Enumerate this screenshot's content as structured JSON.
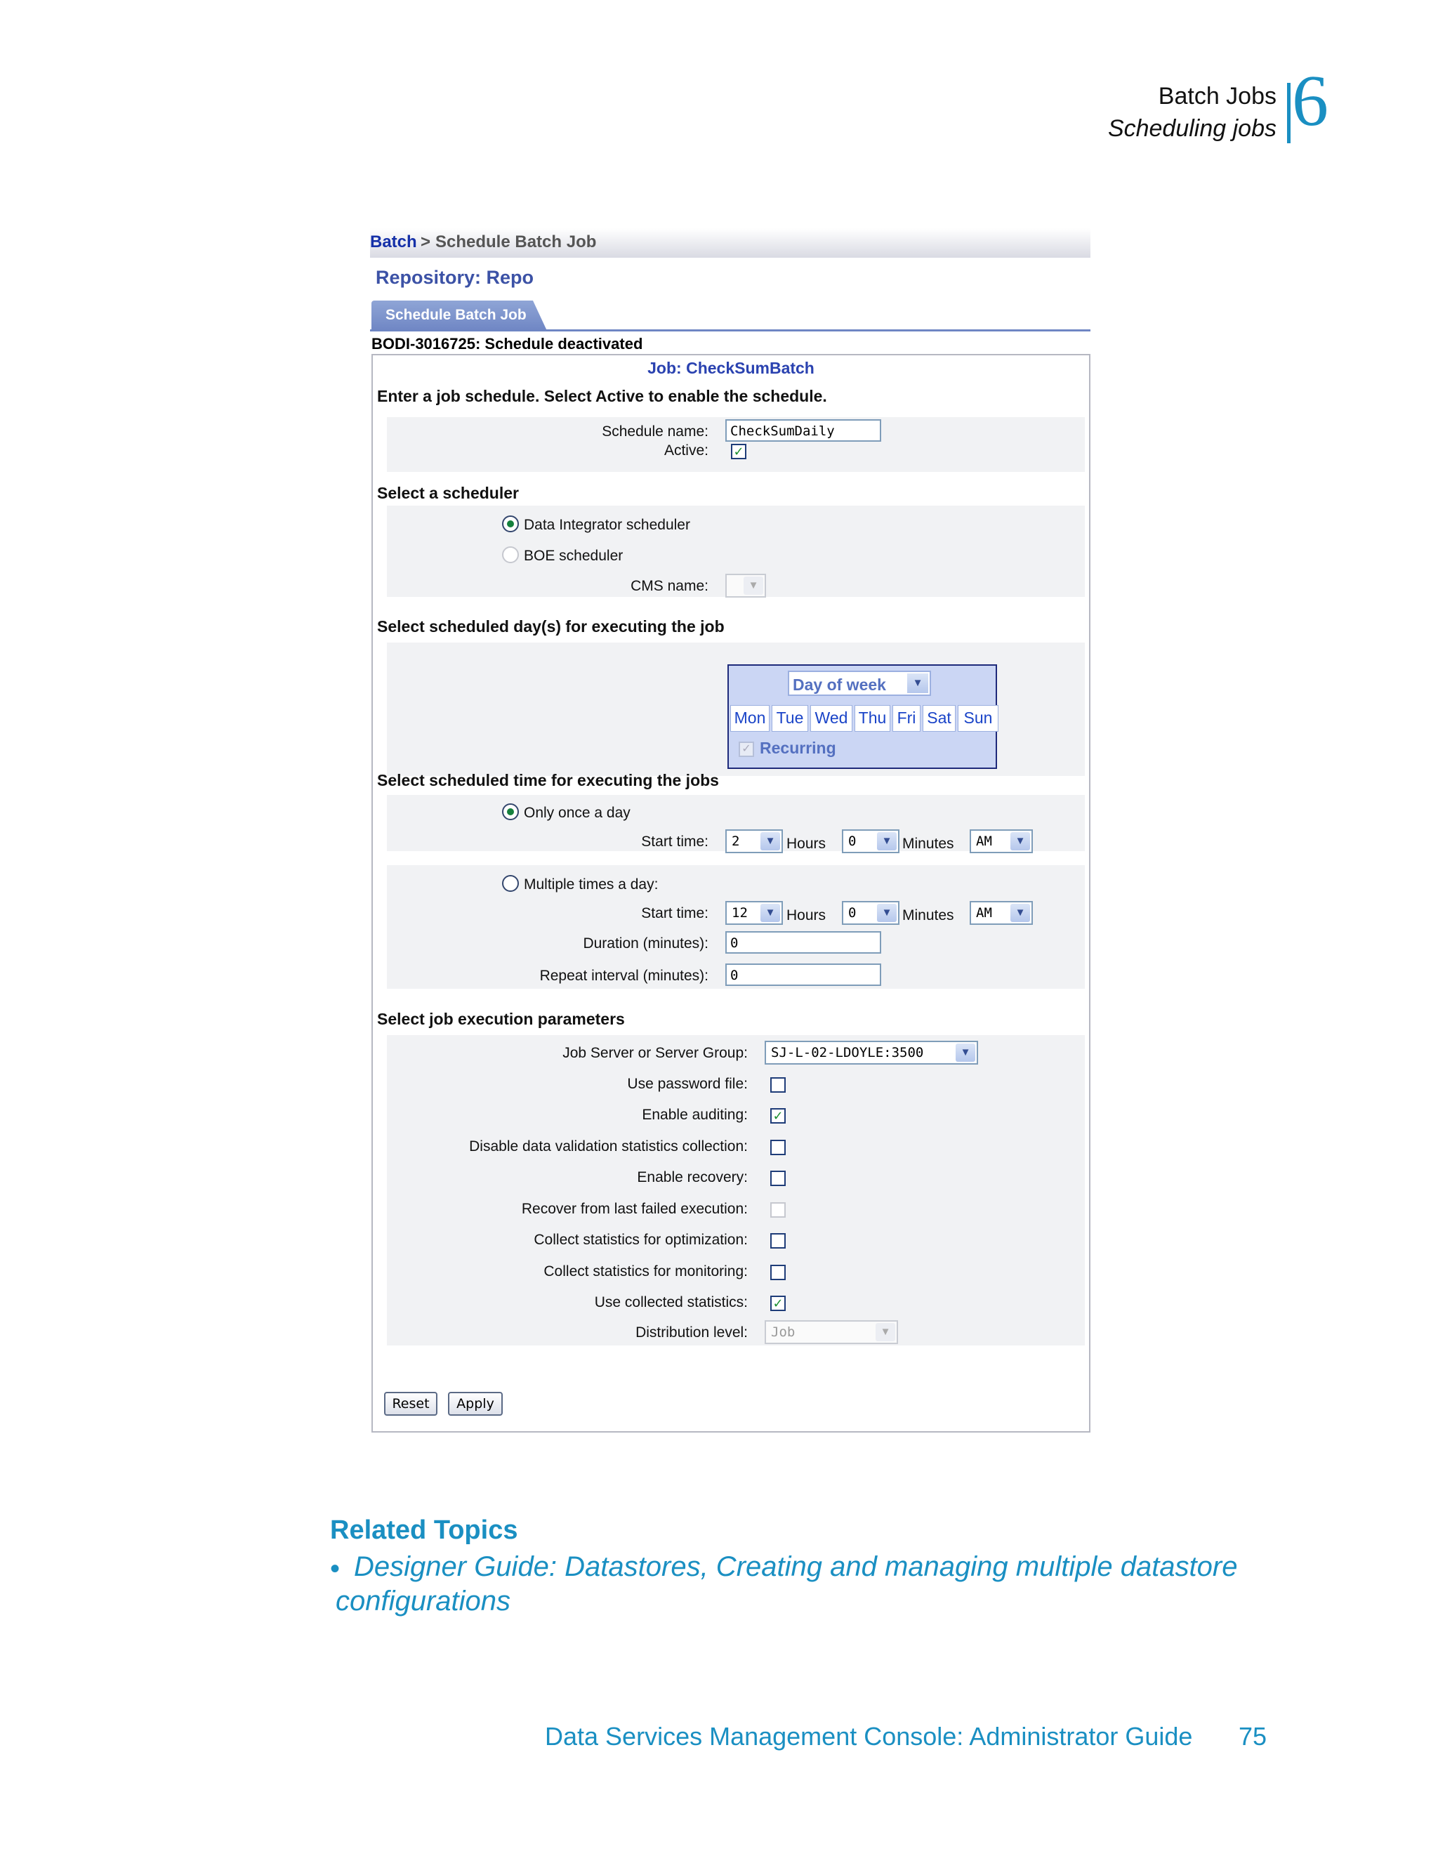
{
  "page_header": {
    "chapter": "Batch Jobs",
    "section": "Scheduling jobs",
    "chapter_number": "6"
  },
  "breadcrumb": {
    "link": "Batch",
    "separator": ">",
    "current": "Schedule Batch Job"
  },
  "repository": "Repository: Repo",
  "tab": "Schedule Batch Job",
  "message": "BODI-3016725: Schedule deactivated",
  "job_title": "Job: CheckSumBatch",
  "intro": "Enter a job schedule. Select Active to enable the schedule.",
  "schedule": {
    "name_label": "Schedule name:",
    "name_value": "CheckSumDaily",
    "active_label": "Active:",
    "active_checked": true
  },
  "scheduler": {
    "heading": "Select a scheduler",
    "option1": "Data Integrator scheduler",
    "option1_selected": true,
    "option2": "BOE scheduler",
    "option2_selected": false,
    "cms_label": "CMS name:",
    "cms_value": ""
  },
  "days": {
    "heading": "Select scheduled day(s) for executing the job",
    "mode": "Day of week",
    "names": [
      "Mon",
      "Tue",
      "Wed",
      "Thu",
      "Fri",
      "Sat",
      "Sun"
    ],
    "recurring_label": "Recurring",
    "recurring_checked": true
  },
  "time": {
    "heading": "Select scheduled time for executing the jobs",
    "once_label": "Only once a day",
    "once_selected": true,
    "multi_label": "Multiple times a day:",
    "multi_selected": false,
    "start_label": "Start time:",
    "hours_label": "Hours",
    "minutes_label": "Minutes",
    "once_hours": "2",
    "once_minutes": "0",
    "once_ampm": "AM",
    "multi_hours": "12",
    "multi_minutes": "0",
    "multi_ampm": "AM",
    "duration_label": "Duration (minutes):",
    "duration_value": "0",
    "repeat_label": "Repeat interval (minutes):",
    "repeat_value": "0"
  },
  "params": {
    "heading": "Select job execution parameters",
    "server_label": "Job Server or Server Group:",
    "server_value": "SJ-L-02-LDOYLE:3500",
    "checks": [
      {
        "label": "Use password file:",
        "checked": false,
        "disabled": false
      },
      {
        "label": "Enable auditing:",
        "checked": true,
        "disabled": false
      },
      {
        "label": "Disable data validation statistics collection:",
        "checked": false,
        "disabled": false
      },
      {
        "label": "Enable recovery:",
        "checked": false,
        "disabled": false
      },
      {
        "label": "Recover from last failed execution:",
        "checked": false,
        "disabled": true
      },
      {
        "label": "Collect statistics for optimization:",
        "checked": false,
        "disabled": false
      },
      {
        "label": "Collect statistics for monitoring:",
        "checked": false,
        "disabled": false
      },
      {
        "label": "Use collected statistics:",
        "checked": true,
        "disabled": false
      }
    ],
    "distribution_label": "Distribution level:",
    "distribution_value": "Job"
  },
  "buttons": {
    "reset": "Reset",
    "apply": "Apply"
  },
  "related": {
    "heading": "Related Topics",
    "bullet": "•",
    "link": "Designer Guide: Datastores, Creating and managing multiple datastore configurations"
  },
  "footer": {
    "title": "Data Services Management Console: Administrator Guide",
    "page": "75"
  },
  "colors": {
    "accent": "#1a8fc2",
    "link_blue": "#1530a8",
    "tab": "#6f86c4"
  },
  "icons": {
    "checkmark": "check-icon",
    "dropdown": "chevron-down-icon"
  }
}
